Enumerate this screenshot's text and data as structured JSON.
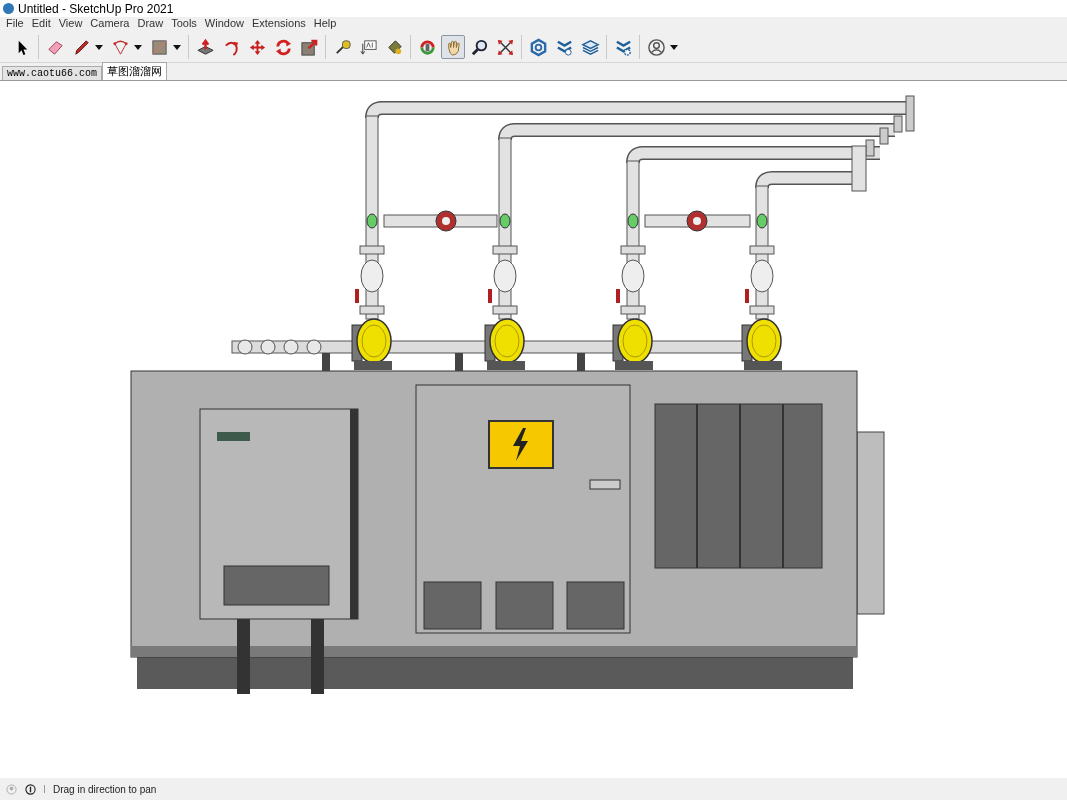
{
  "window": {
    "title": "Untitled - SketchUp Pro 2021"
  },
  "menu": [
    "File",
    "Edit",
    "View",
    "Camera",
    "Draw",
    "Tools",
    "Window",
    "Extensions",
    "Help"
  ],
  "toolbar": {
    "groups": [
      [
        {
          "selected": false,
          "dropdown": false
        }
      ],
      [
        {
          "selected": false,
          "dropdown": false
        },
        {
          "selected": false,
          "dropdown": true
        },
        {
          "selected": false,
          "dropdown": true
        },
        {
          "selected": false,
          "dropdown": true
        }
      ],
      [
        {
          "selected": false,
          "dropdown": false
        },
        {
          "selected": false,
          "dropdown": false
        },
        {
          "selected": false,
          "dropdown": false
        },
        {
          "selected": false,
          "dropdown": false
        },
        {
          "selected": false,
          "dropdown": false
        }
      ],
      [
        {
          "selected": false,
          "dropdown": false
        },
        {
          "selected": false,
          "dropdown": false
        },
        {
          "selected": false,
          "dropdown": false
        }
      ],
      [
        {
          "selected": false,
          "dropdown": false
        },
        {
          "selected": true,
          "dropdown": false
        },
        {
          "selected": false,
          "dropdown": false
        },
        {
          "selected": false,
          "dropdown": false
        }
      ],
      [
        {
          "selected": false,
          "dropdown": false
        },
        {
          "selected": false,
          "dropdown": false
        },
        {
          "selected": false,
          "dropdown": false
        }
      ],
      [
        {
          "selected": false,
          "dropdown": false
        }
      ],
      [
        {
          "selected": false,
          "dropdown": true
        }
      ]
    ]
  },
  "scene_tabs": [
    {
      "label": "www.caotu66.com",
      "selected": false
    },
    {
      "label": "草图溜溜网",
      "selected": true
    }
  ],
  "status_bar": {
    "hint": "Drag in direction to pan"
  }
}
